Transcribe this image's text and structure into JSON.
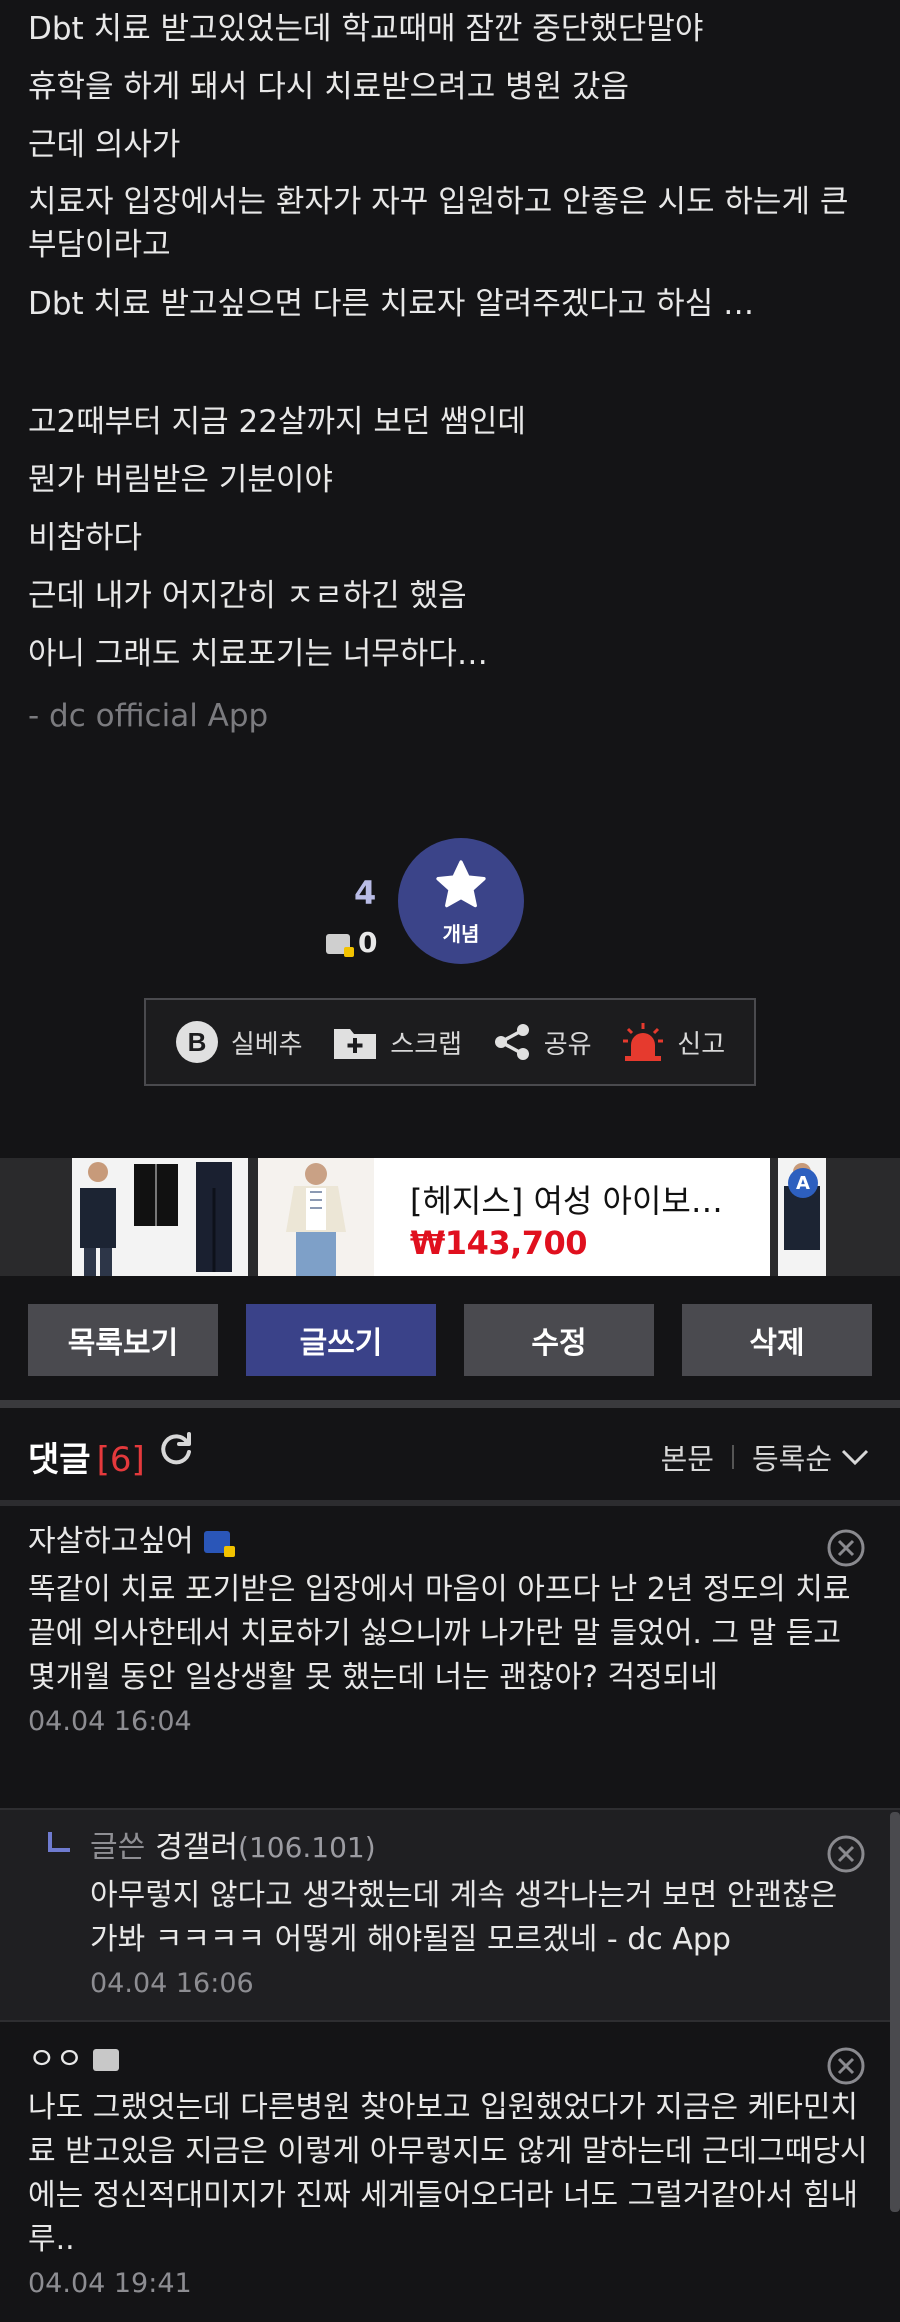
{
  "post": {
    "lines": [
      "Dbt 치료 받고있었는데 학교때매 잠깐 중단했단말야",
      "휴학을 하게 돼서 다시 치료받으려고 병원 갔음",
      "근데 의사가",
      "치료자 입장에서는 환자가 자꾸 입원하고 안좋은 시도 하는게 큰 부담이라고",
      "Dbt 치료 받고싶으면 다른 치료자 알려주겠다고 하심 …",
      "",
      "고2때부터 지금 22살까지 보던 쌤인데",
      "뭔가 버림받은 기분이야",
      "비참하다",
      "근데 내가 어지간히 ㅈㄹ하긴 했음",
      "아니 그래도 치료포기는 너무하다…"
    ],
    "signature": "- dc official App"
  },
  "vote": {
    "recommend_count": "4",
    "fixed_count": "0",
    "button_label": "개념"
  },
  "actions": [
    {
      "label": "실베추",
      "icon": "best-b-icon"
    },
    {
      "label": "스크랩",
      "icon": "scrap-folder-icon"
    },
    {
      "label": "공유",
      "icon": "share-icon"
    },
    {
      "label": "신고",
      "icon": "siren-icon"
    }
  ],
  "ad": {
    "title": "[헤지스] 여성 아이보…",
    "price": "₩143,700",
    "badge": "A"
  },
  "buttons": {
    "list": "목록보기",
    "write": "글쓰기",
    "edit": "수정",
    "delete": "삭제"
  },
  "comments_header": {
    "title": "댓글",
    "count": "[6]",
    "sort_body": "본문",
    "sort_order": "등록순"
  },
  "comments": [
    {
      "nickname": "자살하고싶어",
      "body": "똑같이 치료 포기받은 입장에서 마음이 아프다 난 2년 정도의 치료 끝에 의사한테서 치료하기 싫으니까 나가란 말 들었어. 그 말 듣고 몇개월 동안 일상생활 못 했는데 너는 괜찮아? 걱정되네",
      "date": "04.04 16:04"
    },
    {
      "prefix": "글쓴",
      "nickname": "경갤러",
      "ip": "(106.101)",
      "body": "아무렇지 않다고 생각했는데 계속 생각나는거 보면 안괜찮은가봐 ㅋㅋㅋㅋ 어떻게 해야될질 모르겠네 - dc App",
      "date": "04.04 16:06"
    },
    {
      "nickname": "ㅇㅇ",
      "body": "나도 그랬엇는데 다른병원 찾아보고 입원했었다가 지금은 케타민치료 받고있음 지금은 이렇게 아무렇지도 않게 말하는데 근데그때당시에는 정신적대미지가 진짜 세게들어오더라 너도 그럴거같아서 힘내루..",
      "date": "04.04 19:41"
    }
  ]
}
